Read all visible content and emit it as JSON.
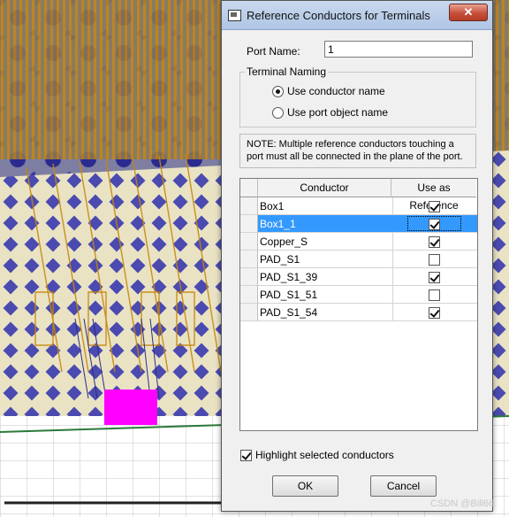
{
  "dialog": {
    "title": "Reference Conductors for Terminals",
    "close_label": "✕",
    "port_name_label": "Port Name:",
    "port_name_value": "1",
    "terminal_naming": {
      "title": "Terminal Naming",
      "options": [
        {
          "label": "Use conductor name",
          "selected": true
        },
        {
          "label": "Use port object name",
          "selected": false
        }
      ]
    },
    "note": "NOTE: Multiple reference conductors touching a port must all be connected in the plane of the port.",
    "table": {
      "headers": [
        "Conductor",
        "Use as Reference"
      ],
      "rows": [
        {
          "conductor": "Box1",
          "use_as_reference": true,
          "selected": false
        },
        {
          "conductor": "Box1_1",
          "use_as_reference": true,
          "selected": true
        },
        {
          "conductor": "Copper_S",
          "use_as_reference": true,
          "selected": false
        },
        {
          "conductor": "PAD_S1",
          "use_as_reference": false,
          "selected": false
        },
        {
          "conductor": "PAD_S1_39",
          "use_as_reference": true,
          "selected": false
        },
        {
          "conductor": "PAD_S1_51",
          "use_as_reference": false,
          "selected": false
        },
        {
          "conductor": "PAD_S1_54",
          "use_as_reference": true,
          "selected": false
        }
      ]
    },
    "highlight_label": "Highlight selected conductors",
    "highlight_checked": true,
    "ok_label": "OK",
    "cancel_label": "Cancel"
  },
  "watermark": "CSDN @Bill66",
  "colors": {
    "selection": "#3399ff",
    "port_highlight": "#ff00ff",
    "trace_orange": "#c8860a",
    "scene_blue": "#3a3aa8"
  }
}
